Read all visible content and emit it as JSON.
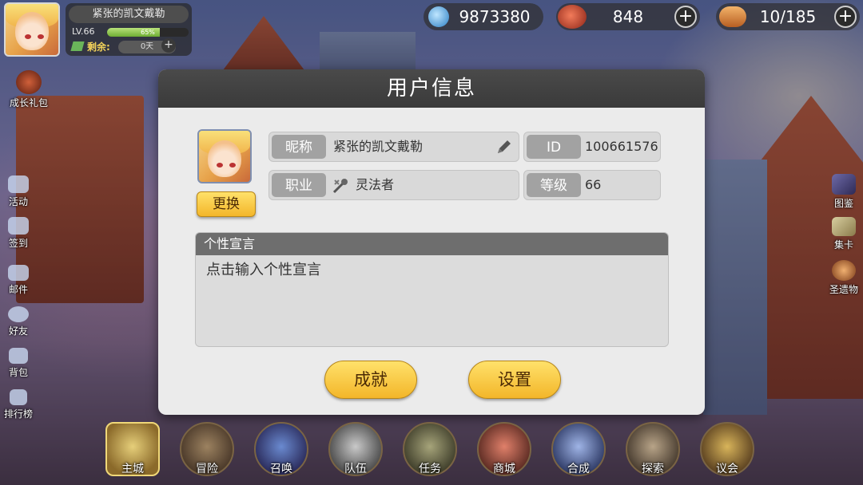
{
  "player": {
    "name": "紧张的凯文戴勒",
    "level": "LV.66",
    "xp_percent_label": "65%",
    "xp_fraction": 0.65,
    "remaining_label": "剩余:",
    "remaining_value": "0天",
    "plus": "+"
  },
  "resources": [
    {
      "name": "crystal",
      "value": "9873380",
      "icon": "blue-crystal-icon",
      "color": "#4aa9e8"
    },
    {
      "name": "meat",
      "value": "848",
      "icon": "meat-icon",
      "color": "#c2412b",
      "plus": "+"
    },
    {
      "name": "stamina",
      "value": "10/185",
      "icon": "bread-icon",
      "color": "#d9813a",
      "plus": "+"
    }
  ],
  "left_menu": [
    {
      "label": "成长礼包",
      "icon": "gift-pack-icon"
    },
    {
      "label": "活动",
      "icon": "megaphone-icon"
    },
    {
      "label": "签到",
      "icon": "calendar-check-icon"
    },
    {
      "label": "邮件",
      "icon": "mail-icon"
    },
    {
      "label": "好友",
      "icon": "friends-icon"
    },
    {
      "label": "背包",
      "icon": "backpack-icon"
    },
    {
      "label": "排行榜",
      "icon": "ranking-icon"
    }
  ],
  "right_menu": [
    {
      "label": "图鉴",
      "icon": "book-icon"
    },
    {
      "label": "集卡",
      "icon": "cards-icon"
    },
    {
      "label": "圣遗物",
      "icon": "relic-icon"
    }
  ],
  "dialog": {
    "title": "用户信息",
    "change_button": "更换",
    "nickname_label": "昵称",
    "nickname_value": "紧张的凯文戴勒",
    "id_label": "ID",
    "id_value": "100661576",
    "job_label": "职业",
    "job_value": "灵法者",
    "level_label": "等级",
    "level_value": "66",
    "signature_header": "个性宣言",
    "signature_placeholder": "点击输入个性宣言",
    "achievement_button": "成就",
    "settings_button": "设置"
  },
  "bottom_nav": [
    {
      "label": "主城",
      "active": true
    },
    {
      "label": "冒险"
    },
    {
      "label": "召唤"
    },
    {
      "label": "队伍"
    },
    {
      "label": "任务"
    },
    {
      "label": "商城"
    },
    {
      "label": "合成"
    },
    {
      "label": "探索"
    },
    {
      "label": "议会"
    }
  ]
}
